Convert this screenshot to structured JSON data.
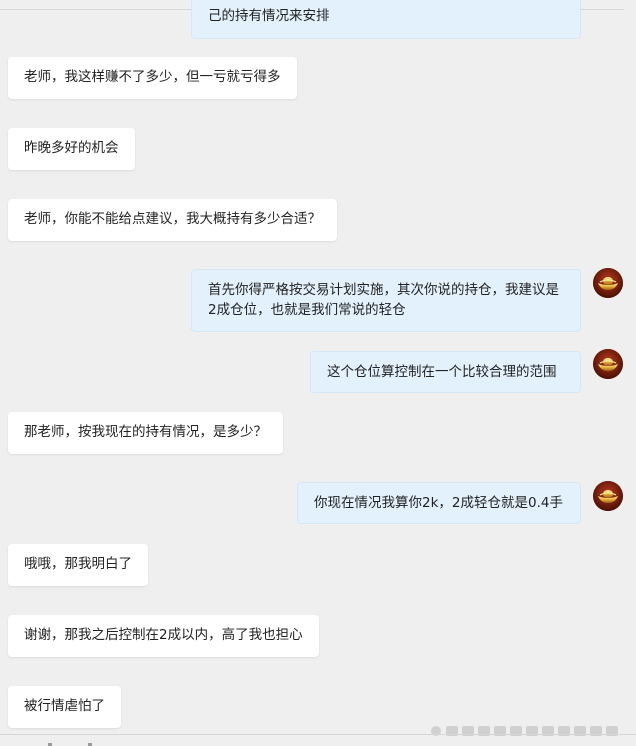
{
  "messages": [
    {
      "side": "right",
      "text": "己的持有情况来安排"
    },
    {
      "side": "left",
      "text": "老师，我这样赚不了多少，但一亏就亏得多"
    },
    {
      "side": "left",
      "text": "昨晚多好的机会"
    },
    {
      "side": "left",
      "text": "老师，你能不能给点建议，我大概持有多少合适？"
    },
    {
      "side": "right",
      "text": "首先你得严格按交易计划实施，其次你说的持仓，我建议是2成仓位，也就是我们常说的轻仓"
    },
    {
      "side": "right",
      "text": "这个仓位算控制在一个比较合理的范围"
    },
    {
      "side": "left",
      "text": "那老师，按我现在的持有情况，是多少？"
    },
    {
      "side": "right",
      "text": "你现在情况我算你2k，2成轻仓就是0.4手"
    },
    {
      "side": "left",
      "text": "哦哦，那我明白了"
    },
    {
      "side": "left",
      "text": "谢谢，那我之后控制在2成以内，高了我也担心"
    },
    {
      "side": "left",
      "text": "被行情虐怕了"
    }
  ],
  "colors": {
    "background": "#efefef",
    "left_bubble": "#ffffff",
    "right_bubble": "#e3f1fd"
  },
  "icons": {
    "avatar": "gold-ingot-avatar-icon"
  }
}
